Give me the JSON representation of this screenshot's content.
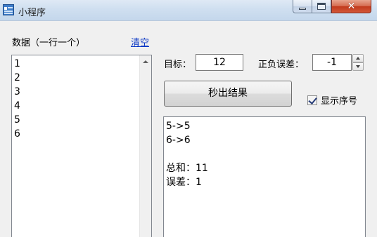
{
  "window": {
    "title": "小程序",
    "controls": {
      "minimize": "minimize",
      "maximize": "maximize",
      "close": "✕"
    }
  },
  "left_panel": {
    "data_label": "数据（一行一个）",
    "clear_link": "清空",
    "list_items": [
      "1",
      "2",
      "3",
      "4",
      "5",
      "6"
    ]
  },
  "right_panel": {
    "target_label": "目标：",
    "target_value": "12",
    "tolerance_label": "正负误差：",
    "tolerance_value": "-1",
    "run_button": "秒出结果",
    "show_index_label": "显示序号",
    "show_index_checked": true,
    "result_lines": [
      "5->5",
      "6->6",
      "",
      "总和：11",
      "误差：1"
    ]
  },
  "colors": {
    "link": "#0b38c5",
    "close_button": "#c2391c",
    "titlebar": "#cfdff0"
  }
}
